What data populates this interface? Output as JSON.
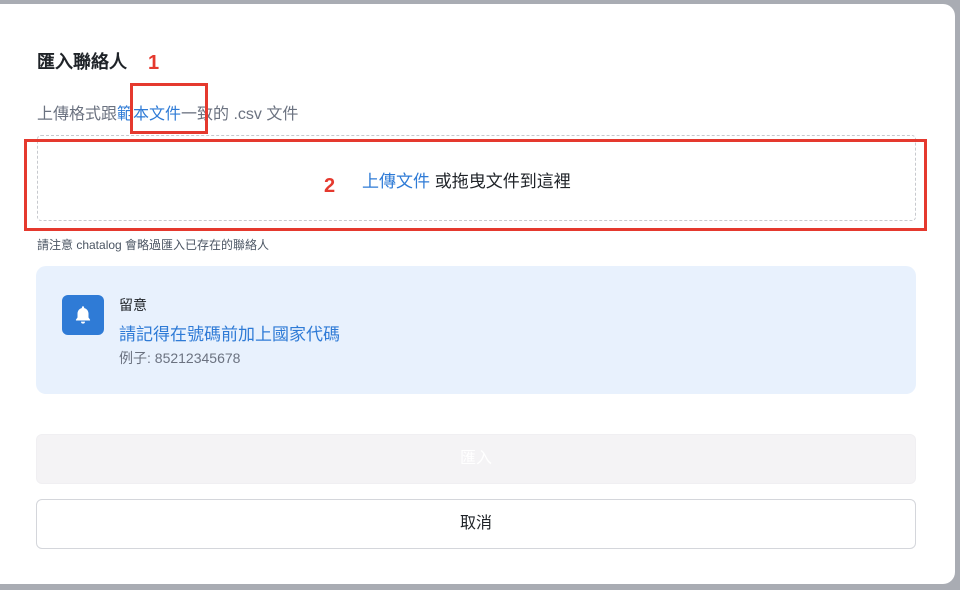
{
  "dialog": {
    "title": "匯入聯絡人",
    "subtitle_prefix": "上傳格式跟",
    "subtitle_link": "範本文件",
    "subtitle_suffix": "一致的 .csv 文件",
    "dropzone_link": "上傳文件",
    "dropzone_text": " 或拖曳文件到這裡",
    "note": "請注意 chatalog 會略過匯入已存在的聯絡人"
  },
  "annotations": {
    "marker_1": "1",
    "marker_2": "2",
    "color": "#e5392e"
  },
  "callout": {
    "icon": "bell-icon",
    "title": "留意",
    "message": "請記得在號碼前加上國家代碼",
    "example": "例子: 85212345678",
    "accent_color": "#2f7bd6",
    "background_color": "#e8f1fd"
  },
  "buttons": {
    "import_label": "匯入",
    "import_disabled": true,
    "cancel_label": "取消"
  }
}
